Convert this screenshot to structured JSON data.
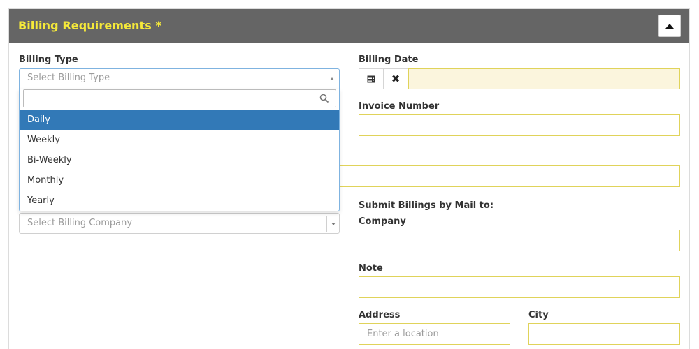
{
  "panel": {
    "title": "Billing Requirements *"
  },
  "billing_type": {
    "label": "Billing Type",
    "placeholder": "Select Billing Type",
    "options": [
      "Daily",
      "Weekly",
      "Bi-Weekly",
      "Monthly",
      "Yearly"
    ],
    "highlighted": "Daily"
  },
  "billing_company": {
    "placeholder": "Select Billing Company"
  },
  "billing_date": {
    "label": "Billing Date"
  },
  "invoice_number": {
    "label": "Invoice Number"
  },
  "mail": {
    "heading": "Submit Billings by Mail to:",
    "company_label": "Company",
    "note_label": "Note",
    "address_label": "Address",
    "address_placeholder": "Enter a location",
    "city_label": "City"
  },
  "colors": {
    "header_bg": "#656565",
    "title": "#f5e93a",
    "field_border": "#e0d35a",
    "highlight": "#3279b7"
  }
}
